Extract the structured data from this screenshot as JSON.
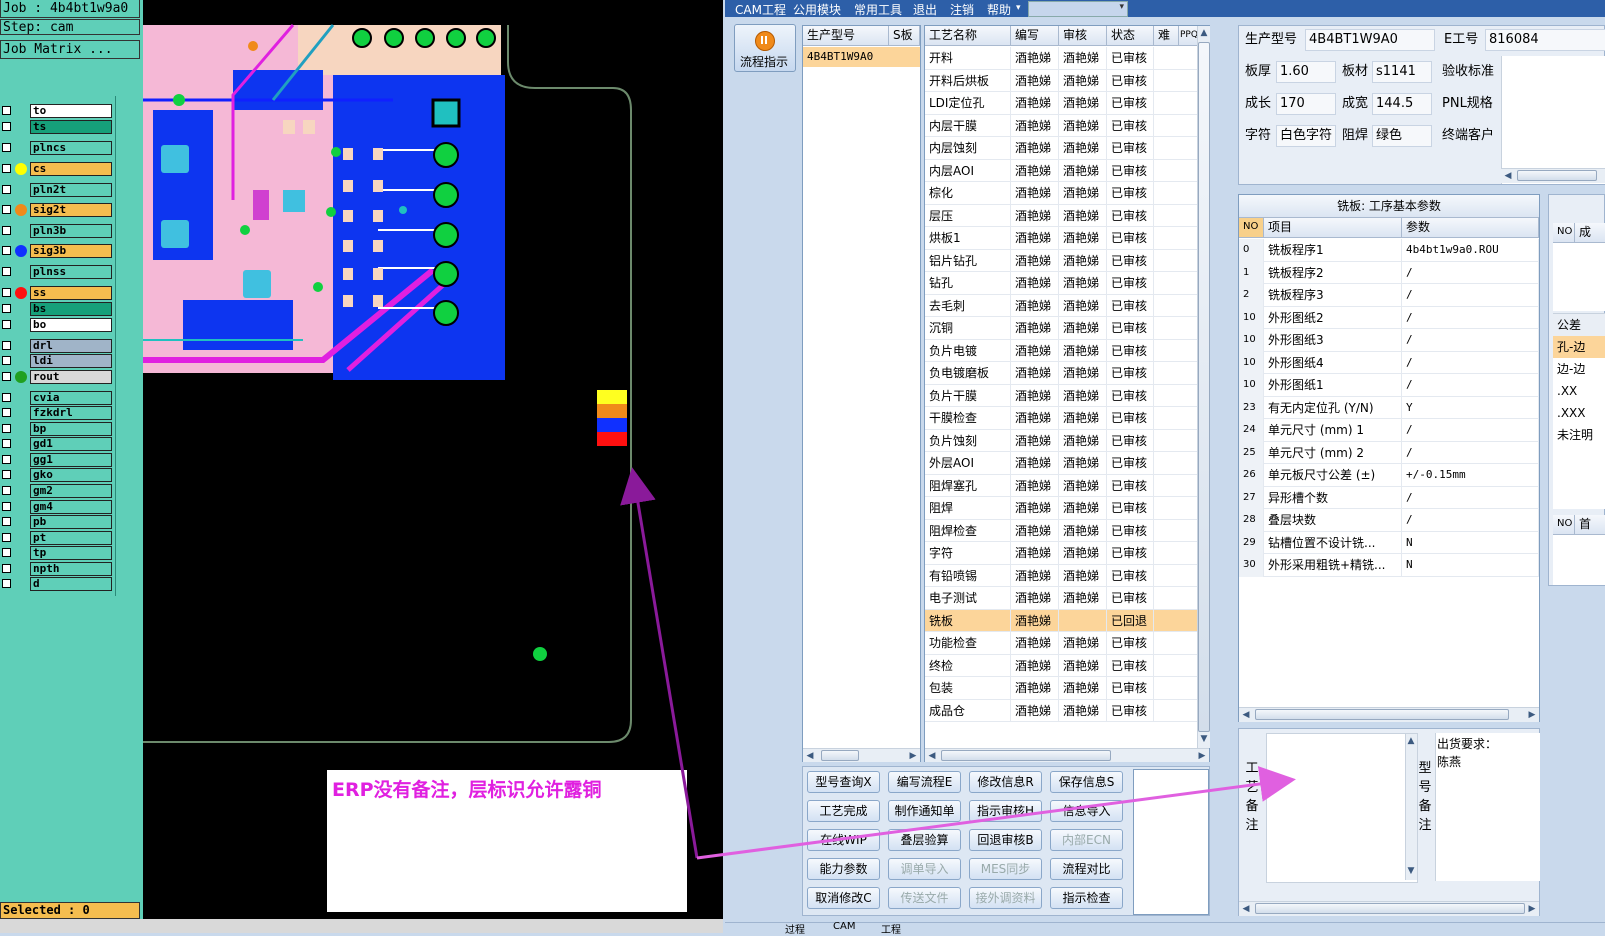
{
  "cam": {
    "job_line": "Job : 4b4bt1w9a0",
    "step_line": "Step: cam",
    "matrix_button": "Job Matrix ...",
    "layers": [
      {
        "name": "to",
        "bg": "#ffffff",
        "dot": ""
      },
      {
        "name": "ts",
        "bg": "#16a07a",
        "dot": ""
      },
      {
        "name": "plncs",
        "bg": "#5fcfb8",
        "dot": ""
      },
      {
        "name": "cs",
        "bg": "#f5bd4f",
        "dot": "#ffff00"
      },
      {
        "name": "pln2t",
        "bg": "#5fcfb8",
        "dot": ""
      },
      {
        "name": "sig2t",
        "bg": "#f5bd4f",
        "dot": "#f08a1a"
      },
      {
        "name": "pln3b",
        "bg": "#5fcfb8",
        "dot": ""
      },
      {
        "name": "sig3b",
        "bg": "#f5bd4f",
        "dot": "#1030ff"
      },
      {
        "name": "plnss",
        "bg": "#5fcfb8",
        "dot": ""
      },
      {
        "name": "ss",
        "bg": "#f5bd4f",
        "dot": "#ff1010"
      },
      {
        "name": "bs",
        "bg": "#16a07a",
        "dot": ""
      },
      {
        "name": "bo",
        "bg": "#ffffff",
        "dot": ""
      },
      {
        "name": "drl",
        "bg": "#a0b4c8",
        "dot": ""
      },
      {
        "name": "ldi",
        "bg": "#a0b4c8",
        "dot": ""
      },
      {
        "name": "rout",
        "bg": "#d8d8d8",
        "dot": "#20a020"
      },
      {
        "name": "cvia",
        "bg": "#5fcfb8",
        "dot": ""
      },
      {
        "name": "fzkdrl",
        "bg": "#5fcfb8",
        "dot": ""
      },
      {
        "name": "bp",
        "bg": "#5fcfb8",
        "dot": ""
      },
      {
        "name": "gd1",
        "bg": "#5fcfb8",
        "dot": ""
      },
      {
        "name": "gg1",
        "bg": "#5fcfb8",
        "dot": ""
      },
      {
        "name": "gko",
        "bg": "#5fcfb8",
        "dot": ""
      },
      {
        "name": "gm2",
        "bg": "#5fcfb8",
        "dot": ""
      },
      {
        "name": "gm4",
        "bg": "#5fcfb8",
        "dot": ""
      },
      {
        "name": "pb",
        "bg": "#5fcfb8",
        "dot": ""
      },
      {
        "name": "pt",
        "bg": "#5fcfb8",
        "dot": ""
      },
      {
        "name": "tp",
        "bg": "#5fcfb8",
        "dot": ""
      },
      {
        "name": "npth",
        "bg": "#5fcfb8",
        "dot": ""
      },
      {
        "name": "d",
        "bg": "#5fcfb8",
        "dot": ""
      }
    ],
    "selected_status": "Selected : 0",
    "annotation": "ERP没有备注，层标识允许露铜"
  },
  "menu": [
    "CAM工程",
    "公用模块",
    "常用工具",
    "退出",
    "注销",
    "帮助"
  ],
  "flow_button": "流程指示",
  "model_table": {
    "headers": [
      "生产型号",
      "S板"
    ],
    "rows": [
      "4B4BT1W9A0"
    ]
  },
  "process_table": {
    "headers": [
      "工艺名称",
      "编写",
      "审核",
      "状态",
      "难",
      "PPQE"
    ],
    "rows": [
      [
        "开料",
        "酒艳娣",
        "酒艳娣",
        "已审核"
      ],
      [
        "开料后烘板",
        "酒艳娣",
        "酒艳娣",
        "已审核"
      ],
      [
        "LDI定位孔",
        "酒艳娣",
        "酒艳娣",
        "已审核"
      ],
      [
        "内层干膜",
        "酒艳娣",
        "酒艳娣",
        "已审核"
      ],
      [
        "内层蚀刻",
        "酒艳娣",
        "酒艳娣",
        "已审核"
      ],
      [
        "内层AOI",
        "酒艳娣",
        "酒艳娣",
        "已审核"
      ],
      [
        "棕化",
        "酒艳娣",
        "酒艳娣",
        "已审核"
      ],
      [
        "层压",
        "酒艳娣",
        "酒艳娣",
        "已审核"
      ],
      [
        "烘板1",
        "酒艳娣",
        "酒艳娣",
        "已审核"
      ],
      [
        "铝片钻孔",
        "酒艳娣",
        "酒艳娣",
        "已审核"
      ],
      [
        "钻孔",
        "酒艳娣",
        "酒艳娣",
        "已审核"
      ],
      [
        "去毛刺",
        "酒艳娣",
        "酒艳娣",
        "已审核"
      ],
      [
        "沉铜",
        "酒艳娣",
        "酒艳娣",
        "已审核"
      ],
      [
        "负片电镀",
        "酒艳娣",
        "酒艳娣",
        "已审核"
      ],
      [
        "负电镀磨板",
        "酒艳娣",
        "酒艳娣",
        "已审核"
      ],
      [
        "负片干膜",
        "酒艳娣",
        "酒艳娣",
        "已审核"
      ],
      [
        "干膜检查",
        "酒艳娣",
        "酒艳娣",
        "已审核"
      ],
      [
        "负片蚀刻",
        "酒艳娣",
        "酒艳娣",
        "已审核"
      ],
      [
        "外层AOI",
        "酒艳娣",
        "酒艳娣",
        "已审核"
      ],
      [
        "阻焊塞孔",
        "酒艳娣",
        "酒艳娣",
        "已审核"
      ],
      [
        "阻焊",
        "酒艳娣",
        "酒艳娣",
        "已审核"
      ],
      [
        "阻焊检查",
        "酒艳娣",
        "酒艳娣",
        "已审核"
      ],
      [
        "字符",
        "酒艳娣",
        "酒艳娣",
        "已审核"
      ],
      [
        "有铅喷锡",
        "酒艳娣",
        "酒艳娣",
        "已审核"
      ],
      [
        "电子测试",
        "酒艳娣",
        "酒艳娣",
        "已审核"
      ],
      [
        "铣板",
        "酒艳娣",
        "",
        "已回退"
      ],
      [
        "功能检查",
        "酒艳娣",
        "酒艳娣",
        "已审核"
      ],
      [
        "终检",
        "酒艳娣",
        "酒艳娣",
        "已审核"
      ],
      [
        "包装",
        "酒艳娣",
        "酒艳娣",
        "已审核"
      ],
      [
        "成品仓",
        "酒艳娣",
        "酒艳娣",
        "已审核"
      ]
    ],
    "selected_index": 25
  },
  "buttons": [
    {
      "label": "型号查询X",
      "disabled": false
    },
    {
      "label": "编写流程E",
      "disabled": false
    },
    {
      "label": "修改信息R",
      "disabled": false
    },
    {
      "label": "保存信息S",
      "disabled": false
    },
    {
      "label": "工艺完成",
      "disabled": false
    },
    {
      "label": "制作通知单",
      "disabled": false
    },
    {
      "label": "指示审核H",
      "disabled": false
    },
    {
      "label": "信息导入",
      "disabled": false
    },
    {
      "label": "在线WIP",
      "disabled": false
    },
    {
      "label": "叠层验算",
      "disabled": false
    },
    {
      "label": "回退审核B",
      "disabled": false
    },
    {
      "label": "内部ECN",
      "disabled": true
    },
    {
      "label": "能力参数",
      "disabled": false
    },
    {
      "label": "调单导入",
      "disabled": true
    },
    {
      "label": "MES同步",
      "disabled": true
    },
    {
      "label": "流程对比",
      "disabled": false
    },
    {
      "label": "取消修改C",
      "disabled": false
    },
    {
      "label": "传送文件",
      "disabled": true
    },
    {
      "label": "接外调资料",
      "disabled": true
    },
    {
      "label": "指示检查",
      "disabled": false
    }
  ],
  "info": {
    "prod_model_label": "生产型号",
    "prod_model": "4B4BT1W9A0",
    "e_no_label": "E工号",
    "e_no": "816084",
    "thickness_label": "板厚",
    "thickness": "1.60",
    "material_label": "板材",
    "material": "s1141",
    "accept_label": "验收标准",
    "growth_label": "成长",
    "growth": "170",
    "finish_label": "成宽",
    "finish": "144.5",
    "pnl_label": "PNL规格",
    "char_label": "字符",
    "char": "白色字符",
    "mask_label": "阻焊",
    "mask": "绿色",
    "customer_label": "终端客户"
  },
  "param_table": {
    "title": "铣板: 工序基本参数",
    "headers": [
      "NO",
      "项目",
      "参数"
    ],
    "rows": [
      [
        "0",
        "铣板程序1",
        "4b4bt1w9a0.ROU"
      ],
      [
        "1",
        "铣板程序2",
        "/"
      ],
      [
        "2",
        "铣板程序3",
        "/"
      ],
      [
        "10",
        "外形图纸2",
        "/"
      ],
      [
        "10",
        "外形图纸3",
        "/"
      ],
      [
        "10",
        "外形图纸4",
        "/"
      ],
      [
        "10",
        "外形图纸1",
        "/"
      ],
      [
        "23",
        "有无内定位孔 (Y/N)",
        "Y"
      ],
      [
        "24",
        "单元尺寸 (mm) 1",
        "/"
      ],
      [
        "25",
        "单元尺寸 (mm) 2",
        "/"
      ],
      [
        "26",
        "单元板尺寸公差 (±)",
        "+/-0.15mm"
      ],
      [
        "27",
        "异形槽个数",
        "/"
      ],
      [
        "28",
        "叠层块数",
        "/"
      ],
      [
        "29",
        "钻槽位置不设计铣...",
        "N"
      ],
      [
        "30",
        "外形采用粗铣+精铣...",
        "N"
      ]
    ]
  },
  "tolerance_panel": {
    "header_cols": [
      "NO",
      "成"
    ],
    "title": "公差",
    "items": [
      "孔-边",
      "边-边",
      ".XX",
      ".XXX",
      "未注明"
    ],
    "bottom_cols": [
      "NO",
      "首"
    ]
  },
  "notes": {
    "craft_label": "工艺备注",
    "model_label": "型号备注",
    "shipping_label": "出货要求：",
    "shipping_value": "陈燕"
  },
  "bottom_tabs": [
    "过程",
    "CAM",
    "工程"
  ]
}
